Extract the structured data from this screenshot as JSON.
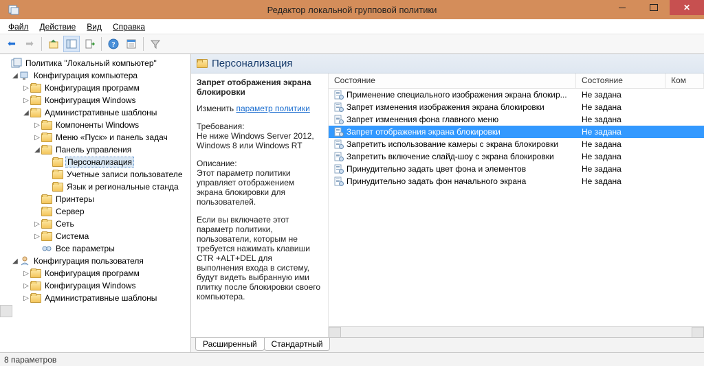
{
  "window": {
    "title": "Редактор локальной групповой политики"
  },
  "menubar": {
    "file": "Файл",
    "action": "Действие",
    "view": "Вид",
    "help": "Справка"
  },
  "tree": {
    "root": "Политика \"Локальный компьютер\"",
    "comp_conf": "Конфигурация компьютера",
    "comp_programs": "Конфигурация программ",
    "comp_windows": "Конфигурация Windows",
    "admin_templates": "Административные шаблоны",
    "win_components": "Компоненты Windows",
    "start_menu": "Меню «Пуск» и панель задач",
    "control_panel": "Панель управления",
    "personalization": "Персонализация",
    "user_accounts": "Учетные записи пользователе",
    "lang_regional": "Язык и региональные станда",
    "printers": "Принтеры",
    "server": "Сервер",
    "network": "Сеть",
    "system": "Система",
    "all_params": "Все параметры",
    "user_conf": "Конфигурация пользователя",
    "user_programs": "Конфигурация программ",
    "user_windows": "Конфигурация Windows",
    "user_admin_templates": "Административные шаблоны"
  },
  "detail": {
    "header": "Персонализация",
    "selected_policy": "Запрет отображения экрана блокировки",
    "edit_label": "Изменить",
    "edit_link": "параметр политики",
    "req_label": "Требования:",
    "req_text": "Не ниже Windows Server 2012, Windows 8 или Windows RT",
    "desc_label": "Описание:",
    "desc_text_1": "Этот параметр политики управляет отображением экрана блокировки для пользователей.",
    "desc_text_2": "Если вы включаете этот параметр политики, пользователи, которым не требуется нажимать клавиши CTR +ALT+DEL для выполнения входа в систему, будут видеть выбранную ими плитку после блокировки своего компьютера."
  },
  "columns": {
    "state": "Состояние",
    "sost": "Состояние",
    "kom": "Ком"
  },
  "rows": [
    {
      "name": "Применение специального изображения экрана блокир...",
      "state": "Не задана",
      "selected": false
    },
    {
      "name": "Запрет изменения изображения экрана блокировки",
      "state": "Не задана",
      "selected": false
    },
    {
      "name": "Запрет изменения фона главного меню",
      "state": "Не задана",
      "selected": false
    },
    {
      "name": "Запрет отображения экрана блокировки",
      "state": "Не задана",
      "selected": true
    },
    {
      "name": "Запретить использование камеры с экрана блокировки",
      "state": "Не задана",
      "selected": false
    },
    {
      "name": "Запретить включение слайд-шоу с экрана блокировки",
      "state": "Не задана",
      "selected": false
    },
    {
      "name": "Принудительно задать цвет фона и элементов",
      "state": "Не задана",
      "selected": false
    },
    {
      "name": "Принудительно задать фон начального экрана",
      "state": "Не задана",
      "selected": false
    }
  ],
  "tabs": {
    "extended": "Расширенный",
    "standard": "Стандартный"
  },
  "statusbar": {
    "count": "8 параметров"
  }
}
